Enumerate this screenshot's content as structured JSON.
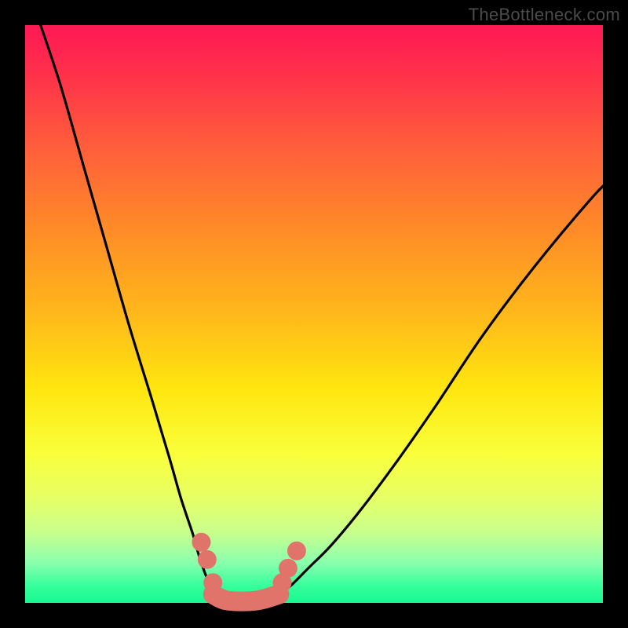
{
  "watermark": "TheBottleneck.com",
  "chart_data": {
    "type": "line",
    "title": "",
    "xlabel": "",
    "ylabel": "",
    "xlim": [
      0,
      1
    ],
    "ylim": [
      0,
      1
    ],
    "grid": false,
    "legend": false,
    "series": [
      {
        "name": "left-curve",
        "x": [
          0.02,
          0.06,
          0.1,
          0.14,
          0.18,
          0.22,
          0.25,
          0.27,
          0.29,
          0.3,
          0.31,
          0.32,
          0.325
        ],
        "y": [
          1.02,
          0.9,
          0.76,
          0.62,
          0.48,
          0.35,
          0.25,
          0.18,
          0.12,
          0.085,
          0.055,
          0.03,
          0.015
        ]
      },
      {
        "name": "right-curve",
        "x": [
          0.44,
          0.46,
          0.49,
          0.53,
          0.58,
          0.64,
          0.71,
          0.79,
          0.88,
          0.98,
          1.02
        ],
        "y": [
          0.015,
          0.03,
          0.06,
          0.1,
          0.16,
          0.24,
          0.34,
          0.46,
          0.58,
          0.7,
          0.74
        ]
      },
      {
        "name": "v-bottom",
        "x": [
          0.325,
          0.35,
          0.4,
          0.44
        ],
        "y": [
          0.015,
          0.004,
          0.004,
          0.015
        ]
      }
    ],
    "markers": [
      {
        "name": "bead-left-1",
        "x": 0.305,
        "y": 0.105
      },
      {
        "name": "bead-left-2",
        "x": 0.315,
        "y": 0.075
      },
      {
        "name": "bead-left-3",
        "x": 0.325,
        "y": 0.035
      },
      {
        "name": "bead-right-1",
        "x": 0.445,
        "y": 0.035
      },
      {
        "name": "bead-right-2",
        "x": 0.455,
        "y": 0.06
      },
      {
        "name": "bead-right-3",
        "x": 0.47,
        "y": 0.09
      }
    ],
    "colors": {
      "curve": "#000000",
      "v_accent": "#e0746a",
      "gradient_top": "#ff1955",
      "gradient_bottom": "#18f792"
    }
  }
}
